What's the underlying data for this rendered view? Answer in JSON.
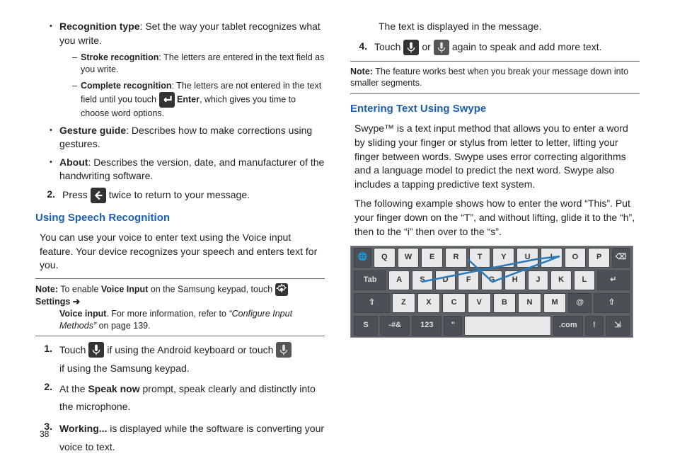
{
  "page_number": "38",
  "left": {
    "bullets": {
      "recog_type_label": "Recognition type",
      "recog_type_text": ": Set the way your tablet recognizes what you write.",
      "stroke_label": "Stroke recognition",
      "stroke_text": ": The letters are entered in the text field as you write.",
      "complete_label": "Complete recognition",
      "complete_text_a": ": The letters are not entered in the text field until you touch ",
      "complete_enter": "Enter",
      "complete_text_b": ", which gives you time to choose word options.",
      "gesture_label": "Gesture guide",
      "gesture_text": ": Describes how to make corrections using gestures.",
      "about_label": "About",
      "about_text": ": Describes the version, date, and manufacturer of the handwriting software."
    },
    "step2": {
      "num": "2.",
      "pre": "Press ",
      "post": " twice to return to your message."
    },
    "heading1": "Using Speech Recognition",
    "intro": "You can use your voice to enter text using the Voice input feature. Your device recognizes your speech and enters text for you.",
    "note": {
      "label": "Note:",
      "a": " To enable ",
      "voice_input": "Voice Input",
      "b": " on the Samsung keypad, touch ",
      "settings": "Settings",
      "arrow": " ➔ ",
      "voice_input2": "Voice input",
      "c": ". For more information, refer to ",
      "ref": "“Configure Input Methods”",
      "d": " on page 139."
    },
    "steps": {
      "s1": {
        "num": "1.",
        "a": "Touch ",
        "b": " if using the Android keyboard or touch ",
        "c": "if using the Samsung keypad."
      },
      "s2": {
        "num": "2.",
        "a": "At the ",
        "speak_now": "Speak now",
        "b": " prompt, speak clearly and distinctly into the microphone."
      },
      "s3": {
        "num": "3.",
        "working": "Working...",
        "a": " is displayed while the software is converting your voice to text."
      }
    }
  },
  "right": {
    "cont_text": "The text is displayed in the message.",
    "s4": {
      "num": "4.",
      "a": "Touch ",
      "or": " or ",
      "b": " again to speak and add more text."
    },
    "note": {
      "label": "Note:",
      "text": " The feature works best when you break your message down into smaller segments."
    },
    "heading": "Entering Text Using Swype",
    "p1": "Swype™ is a text input method that allows you to enter a word by sliding your finger or stylus from letter to letter, lifting your finger between words. Swype uses error correcting algorithms and a language model to predict the next word. Swype also includes a tapping predictive text system.",
    "p2": "The following example shows how to enter the word “This”. Put your finger down on the “T”, and without lifting, glide it to the “h”, then to the “i” then over to the “s”.",
    "keyboard": {
      "row1": [
        "Q",
        "W",
        "E",
        "R",
        "T",
        "Y",
        "U",
        "I",
        "O",
        "P"
      ],
      "row2": [
        "A",
        "S",
        "D",
        "F",
        "G",
        "H",
        "J",
        "K",
        "L"
      ],
      "row3": [
        "Z",
        "X",
        "C",
        "V",
        "B",
        "N",
        "M"
      ],
      "tab": "Tab",
      "num": "123",
      "com": ".com",
      "sym": "-#&"
    }
  }
}
